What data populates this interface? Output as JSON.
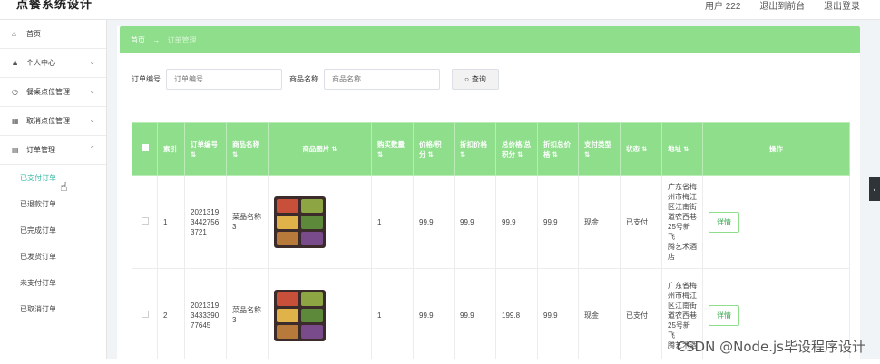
{
  "app": {
    "title": "点餐系统设计",
    "user": "用户 222",
    "back_home": "退出到前台",
    "logout": "退出登录"
  },
  "sidebar": {
    "items": [
      {
        "icon": "home-icon",
        "glyph": "⌂",
        "label": "首页",
        "has_arrow": false
      },
      {
        "icon": "user-icon",
        "glyph": "♟",
        "label": "个人中心",
        "has_arrow": true
      },
      {
        "icon": "clock-icon",
        "glyph": "◷",
        "label": "餐桌点位管理",
        "has_arrow": true
      },
      {
        "icon": "table-icon",
        "glyph": "▦",
        "label": "取消点位管理",
        "has_arrow": true
      },
      {
        "icon": "order-icon",
        "glyph": "▤",
        "label": "订单管理",
        "has_arrow": true,
        "expanded": true
      }
    ],
    "subitems": [
      "已支付订单",
      "已退款订单",
      "已完成订单",
      "已发货订单",
      "未支付订单",
      "已取消订单"
    ],
    "active_subitem": "已支付订单"
  },
  "breadcrumb": {
    "home": "首页",
    "sep": "→",
    "current": "订单管理"
  },
  "search": {
    "order_no_label": "订单编号",
    "order_no_placeholder": "订单编号",
    "product_label": "商品名称",
    "product_placeholder": "商品名称",
    "button": "查询"
  },
  "table": {
    "headers": [
      "索引",
      "订单编号 ⇅",
      "商品名称 ⇅",
      "商品图片 ⇅",
      "购买数量 ⇅",
      "价格/积分 ⇅",
      "折扣价格 ⇅",
      "总价格/总积分 ⇅",
      "折扣总价格 ⇅",
      "支付类型 ⇅",
      "状态 ⇅",
      "地址 ⇅",
      "操作"
    ],
    "rows": [
      {
        "index": "1",
        "order_no": "2021319344275637 21",
        "order_no_lines": [
          "2021319",
          "3442756",
          "3721"
        ],
        "product": "菜品名称3",
        "product_lines": [
          "菜品名称",
          "3"
        ],
        "qty": "1",
        "price": "99.9",
        "discount_price": "99.9",
        "total": "99.9",
        "discount_total": "99.9",
        "pay_type": "现金",
        "status": "已支付",
        "address_lines": [
          "广东省梅",
          "州市梅江",
          "区江南街",
          "道农西巷",
          "25号新飞",
          "腾艺术酒",
          "店"
        ],
        "action": "详情"
      },
      {
        "index": "2",
        "order_no_lines": [
          "2021319",
          "3433390",
          "77645"
        ],
        "product_lines": [
          "菜品名称",
          "3"
        ],
        "qty": "1",
        "price": "99.9",
        "discount_price": "99.9",
        "total": "199.8",
        "discount_total": "99.9",
        "pay_type": "现金",
        "status": "已支付",
        "address_lines": [
          "广东省梅",
          "州市梅江",
          "区江南街",
          "道农西巷",
          "25号新飞",
          "腾艺术酒"
        ],
        "action": "详情"
      }
    ]
  },
  "watermark": "CSDN @Node.js毕设程序设计"
}
